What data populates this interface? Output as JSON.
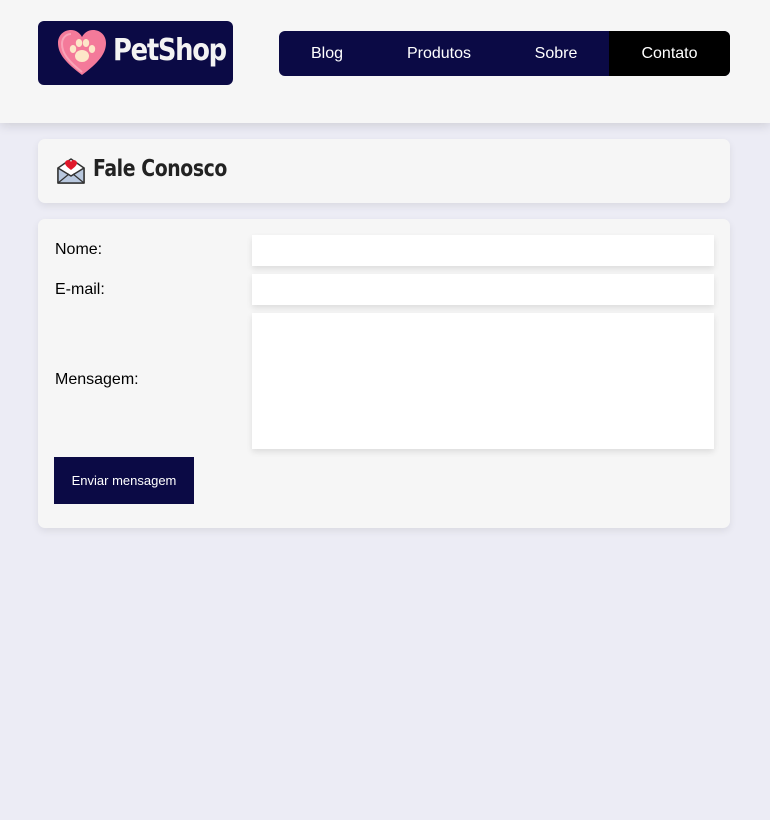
{
  "header": {
    "logo": {
      "icon": "heart-paw-icon",
      "text": "PetShop"
    },
    "nav": [
      {
        "label": "Blog",
        "active": false
      },
      {
        "label": "Produtos",
        "active": false
      },
      {
        "label": "Sobre",
        "active": false
      },
      {
        "label": "Contato",
        "active": true
      }
    ]
  },
  "page": {
    "title_icon": "love-letter-icon",
    "title": "Fale Conosco"
  },
  "form": {
    "name_label": "Nome:",
    "name_value": "",
    "email_label": "E-mail:",
    "email_value": "",
    "message_label": "Mensagem:",
    "message_value": "",
    "submit_label": "Enviar mensagem"
  },
  "colors": {
    "brand_dark": "#0b0a45",
    "active_nav": "#000000",
    "page_bg": "#ececf5",
    "card_bg": "#f6f6f6",
    "heart": "#f47a9a"
  }
}
